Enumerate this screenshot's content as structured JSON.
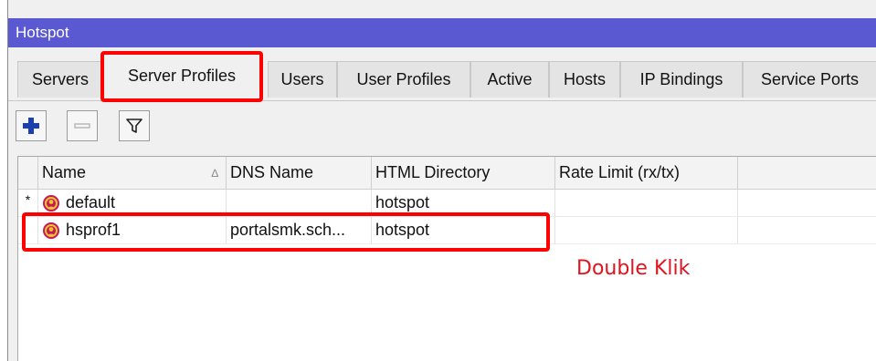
{
  "window": {
    "title": "Hotspot"
  },
  "tabs": [
    {
      "label": "Servers",
      "active": false
    },
    {
      "label": "Server Profiles",
      "active": true
    },
    {
      "label": "Users",
      "active": false
    },
    {
      "label": "User Profiles",
      "active": false
    },
    {
      "label": "Active",
      "active": false
    },
    {
      "label": "Hosts",
      "active": false
    },
    {
      "label": "IP Bindings",
      "active": false
    },
    {
      "label": "Service Ports",
      "active": false
    }
  ],
  "toolbar": {
    "add_icon": "plus-icon",
    "remove_icon": "minus-icon",
    "filter_icon": "filter-icon"
  },
  "table": {
    "columns": [
      "Name",
      "DNS Name",
      "HTML Directory",
      "Rate Limit (rx/tx)"
    ],
    "sort_indicator": "∆",
    "rows": [
      {
        "marker": "*",
        "icon": "hotspot-profile-icon",
        "name": "default",
        "dns_name": "",
        "html_directory": "hotspot",
        "rate_limit": ""
      },
      {
        "marker": "",
        "icon": "hotspot-profile-icon",
        "name": "hsprof1",
        "dns_name": "portalsmk.sch...",
        "html_directory": "hotspot",
        "rate_limit": ""
      }
    ]
  },
  "annotation": {
    "text": "Double Klik",
    "color": "#e0141e"
  },
  "colors": {
    "titlebar": "#5b59d1",
    "highlight": "#ff0000",
    "add_icon": "#1a3fb0"
  }
}
